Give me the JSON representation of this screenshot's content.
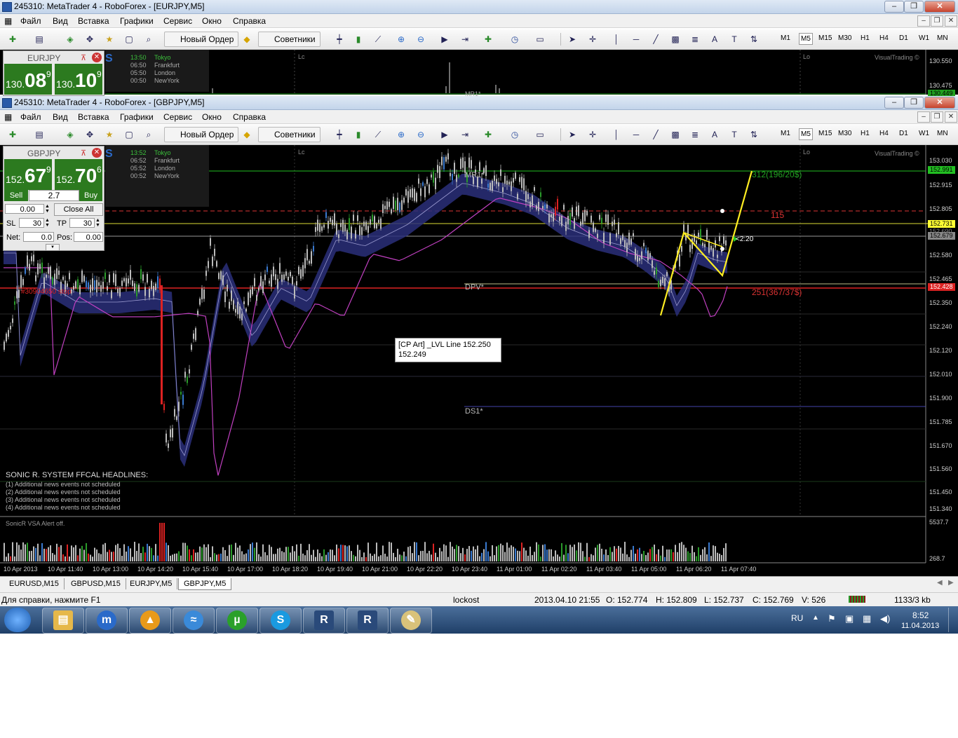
{
  "window1": {
    "title": "245310: MetaTrader 4 - RoboForex - [EURJPY,M5]",
    "symbol": "EURJPY",
    "bid_big": "130.",
    "bid_pips": "08",
    "bid_tail": "9",
    "ask_big": "130.",
    "ask_pips": "10",
    "ask_tail": "9",
    "sessions": [
      {
        "time": "13:50",
        "city": "Tokyo"
      },
      {
        "time": "06:50",
        "city": "Frankfurt"
      },
      {
        "time": "05:50",
        "city": "London"
      },
      {
        "time": "00:50",
        "city": "NewYork"
      }
    ],
    "prices": [
      "130.550",
      "130.475",
      "130.449"
    ],
    "label_mr1": "MR1*",
    "label_lc": "Lc",
    "label_lo": "Lo",
    "brand": "VisualTrading ©"
  },
  "menu": [
    "Файл",
    "Вид",
    "Вставка",
    "Графики",
    "Сервис",
    "Окно",
    "Справка"
  ],
  "toolbar": {
    "new_order": "Новый Ордер",
    "advisors": "Советники",
    "timeframes": [
      "M1",
      "M5",
      "M15",
      "M30",
      "H1",
      "H4",
      "D1",
      "W1",
      "MN"
    ],
    "active_tf": "M5",
    "text_tool": "A"
  },
  "window2": {
    "title": "245310: MetaTrader 4 - RoboForex - [GBPJPY,M5]",
    "symbol": "GBPJPY",
    "bid_big": "152.",
    "bid_pips": "67",
    "bid_tail": "9",
    "ask_big": "152.",
    "ask_pips": "70",
    "ask_tail": "6",
    "sell": "Sell",
    "buy": "Buy",
    "spread": "2.7",
    "lots": "0.00",
    "close_all": "Close All",
    "sl_label": "SL",
    "sl_value": "30",
    "tp_label": "TP",
    "tp_value": "30",
    "net_label": "Net:",
    "net_value": "0.0",
    "pos_label": "Pos:",
    "pos_value": "0.00",
    "sessions": [
      {
        "time": "13:52",
        "city": "Tokyo"
      },
      {
        "time": "06:52",
        "city": "Frankfurt"
      },
      {
        "time": "05:52",
        "city": "London"
      },
      {
        "time": "00:52",
        "city": "NewYork"
      }
    ],
    "label_lc": "Lc",
    "label_lo": "Lo",
    "brand": "VisualTrading ©",
    "label_mr1": "MR1*",
    "label_dpv": "DPV*",
    "label_ds1": "DS1*",
    "label_312": "312(196/20$)",
    "label_115": "115",
    "label_251": "251(367/37$)",
    "label_timer": "<2:20",
    "stop_label": "#30904650 stop",
    "tooltip_line1": "[CP Art]  _LVL Line 152.250",
    "tooltip_line2": "152.249",
    "headline_title": "SONIC R. SYSTEM  FFCAL HEADLINES:",
    "headlines": [
      "(1)  Additional news events not scheduled",
      "(2)  Additional news events not scheduled",
      "(3)  Additional news events not scheduled",
      "(4)  Additional news events not scheduled"
    ],
    "volume_label": "SonicR VSA   Alert off.",
    "volume_max": "5537.7",
    "volume_min": "268.7",
    "price_ticks": [
      "153.030",
      "152.991",
      "152.915",
      "152.805",
      "152.731",
      "152.690",
      "152.679",
      "152.580",
      "152.465",
      "152.428",
      "152.350",
      "152.240",
      "152.120",
      "152.010",
      "151.900",
      "151.785",
      "151.670",
      "151.560",
      "151.450",
      "151.340"
    ],
    "badge_green": "152.991",
    "badge_yellow": "152.731",
    "badge_gray": "152.679",
    "badge_red": "152.428",
    "time_ticks": [
      "10 Apr 2013",
      "10 Apr 11:40",
      "10 Apr 13:00",
      "10 Apr 14:20",
      "10 Apr 15:40",
      "10 Apr 17:00",
      "10 Apr 18:20",
      "10 Apr 19:40",
      "10 Apr 21:00",
      "10 Apr 22:20",
      "10 Apr 23:40",
      "11 Apr 01:00",
      "11 Apr 02:20",
      "11 Apr 03:40",
      "11 Apr 05:00",
      "11 Apr 06:20",
      "11 Apr 07:40"
    ]
  },
  "tabs": [
    "EURUSD,M15",
    "GBPUSD,M15",
    "EURJPY,M5",
    "GBPJPY,M5"
  ],
  "active_tab": "GBPJPY,M5",
  "status": {
    "help": "Для справки, нажмите F1",
    "profile": "lockost",
    "datetime": "2013.04.10 21:55",
    "open": "O: 152.774",
    "high": "H: 152.809",
    "low": "L: 152.737",
    "close": "C: 152.769",
    "volume": "V: 526",
    "traffic": "1133/3 kb"
  },
  "taskbar": {
    "lang": "RU",
    "time": "8:52",
    "date": "11.04.2013"
  }
}
